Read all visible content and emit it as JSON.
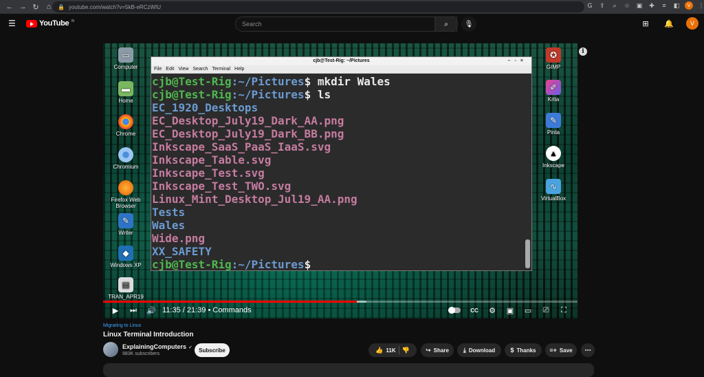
{
  "browser": {
    "url": "youtube.com/watch?v=5kB-eRCzWIU",
    "profile_initial": "V"
  },
  "youtube": {
    "logo_text": "YouTube",
    "logo_cc": "IN",
    "search_placeholder": "Search",
    "avatar_initial": "V"
  },
  "video": {
    "terminal": {
      "title": "cjb@Test-Rig: ~/Pictures",
      "menu": [
        "File",
        "Edit",
        "View",
        "Search",
        "Terminal",
        "Help"
      ],
      "prompt_user": "cjb@Test-Rig",
      "prompt_path": ":~/Pictures",
      "prompt_suffix": "$",
      "cmd1": " mkdir Wales",
      "cmd2": " ls",
      "entries": [
        {
          "name": "EC_1920_Desktops",
          "kind": "dir"
        },
        {
          "name": "EC_Desktop_July19_Dark_AA.png",
          "kind": "file"
        },
        {
          "name": "EC_Desktop_July19_Dark_BB.png",
          "kind": "file"
        },
        {
          "name": "Inkscape_SaaS_PaaS_IaaS.svg",
          "kind": "file"
        },
        {
          "name": "Inkscape_Table.svg",
          "kind": "file"
        },
        {
          "name": "Inkscape_Test.svg",
          "kind": "file"
        },
        {
          "name": "Inkscape_Test_TWO.svg",
          "kind": "file"
        },
        {
          "name": "Linux_Mint_Desktop_Jul19_AA.png",
          "kind": "file"
        },
        {
          "name": "Tests",
          "kind": "dir"
        },
        {
          "name": "Wales",
          "kind": "dir"
        },
        {
          "name": "Wide.png",
          "kind": "file"
        },
        {
          "name": "XX_SAFETY",
          "kind": "dir"
        }
      ]
    },
    "desktop_left": [
      "Computer",
      "Home",
      "Chrome",
      "Chromium",
      "Firefox Web Browser",
      "Writer",
      "Windows XP",
      "TRAN_APR19"
    ],
    "desktop_right": [
      "GIMP",
      "Krita",
      "Pinta",
      "Inkscape",
      "VirtualBox"
    ],
    "time_display": "11:35 / 21:39 • Commands",
    "progress_fraction": 0.535,
    "buffered_fraction": 0.555
  },
  "meta": {
    "playlist_link": "Migrating to Linux",
    "title": "Linux Terminal Introduction",
    "channel_name": "ExplainingComputers",
    "subscribers": "983K subscribers",
    "subscribe_label": "Subscribe",
    "likes": "11K",
    "share_label": "Share",
    "download_label": "Download",
    "thanks_label": "Thanks",
    "save_label": "Save"
  }
}
